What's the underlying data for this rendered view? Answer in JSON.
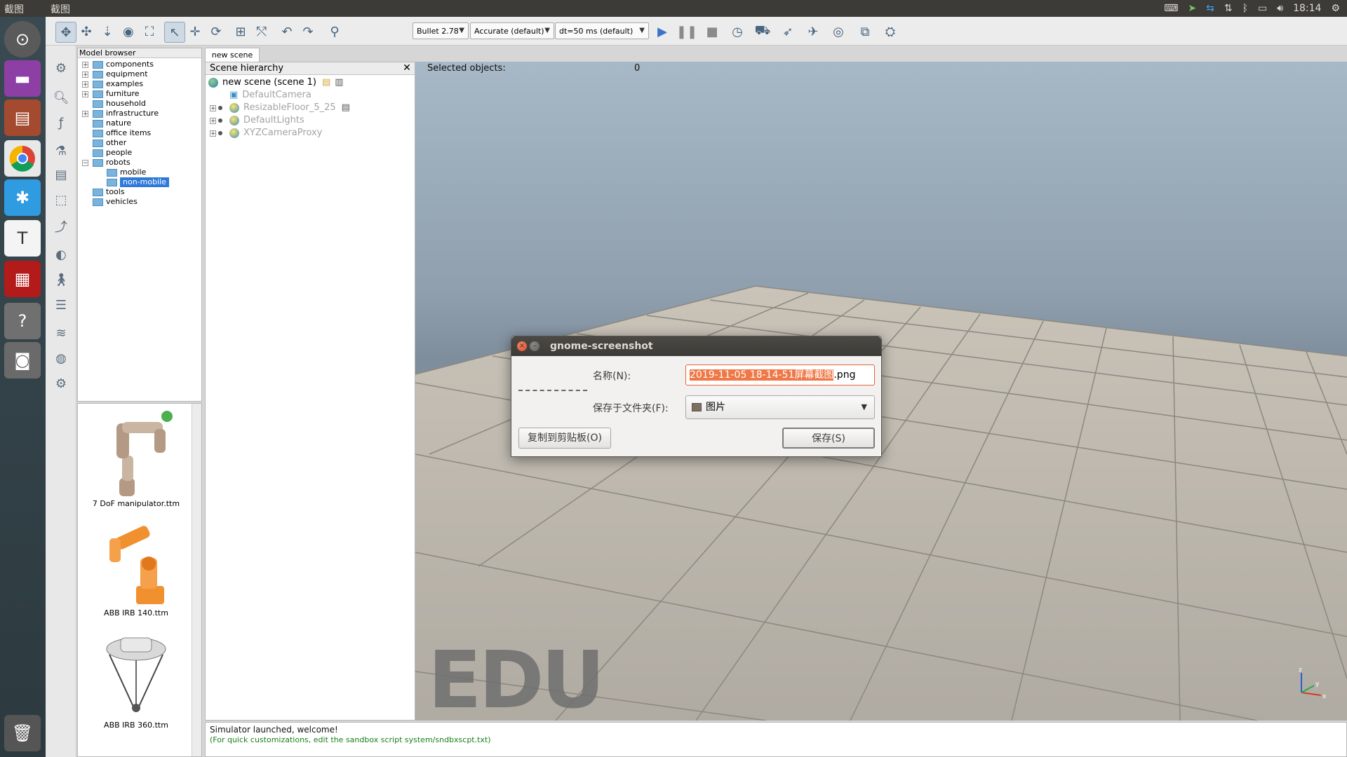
{
  "topbar": {
    "app_name": "截图",
    "menu_label": "截图",
    "time": "18:14"
  },
  "toolbar": {
    "engine": "Bullet 2.78",
    "accuracy": "Accurate (default)",
    "timestep": "dt=50 ms (default)"
  },
  "model_browser": {
    "title": "Model browser",
    "items": [
      {
        "label": "components"
      },
      {
        "label": "equipment"
      },
      {
        "label": "examples"
      },
      {
        "label": "furniture"
      },
      {
        "label": "household"
      },
      {
        "label": "infrastructure"
      },
      {
        "label": "nature"
      },
      {
        "label": "office items"
      },
      {
        "label": "other"
      },
      {
        "label": "people"
      },
      {
        "label": "robots"
      },
      {
        "label": "mobile"
      },
      {
        "label": "non-mobile"
      },
      {
        "label": "tools"
      },
      {
        "label": "vehicles"
      }
    ],
    "thumbnails": [
      {
        "label": "7 DoF manipulator.ttm"
      },
      {
        "label": "ABB IRB 140.ttm"
      },
      {
        "label": "ABB IRB 360.ttm"
      }
    ]
  },
  "scene": {
    "tab": "new scene",
    "header": "Scene hierarchy",
    "root": "new scene (scene 1)",
    "objects": [
      {
        "label": "DefaultCamera"
      },
      {
        "label": "ResizableFloor_5_25"
      },
      {
        "label": "DefaultLights"
      },
      {
        "label": "XYZCameraProxy"
      }
    ]
  },
  "viewport": {
    "selected_label": "Selected objects:",
    "selected_count": "0",
    "watermark": "EDU",
    "axis_z": "z",
    "axis_x": "x",
    "axis_y": "y"
  },
  "console": {
    "line1": "Simulator launched, welcome!",
    "line2": "(For quick customizations, edit the sandbox script system/sndbxscpt.txt)"
  },
  "dialog": {
    "title": "gnome-screenshot",
    "name_label": "名称(N):",
    "filename_selected": "2019-11-05 18-14-51屏幕截图",
    "filename_ext": ".png",
    "folder_label": "保存于文件夹(F):",
    "folder_value": "图片",
    "copy_button": "复制到剪贴板(O)",
    "save_button": "保存(S)"
  },
  "colors": {
    "selection": "#2f7ad9",
    "dialog_highlight": "#f07746",
    "ubuntu_panel": "#3c3b37"
  }
}
